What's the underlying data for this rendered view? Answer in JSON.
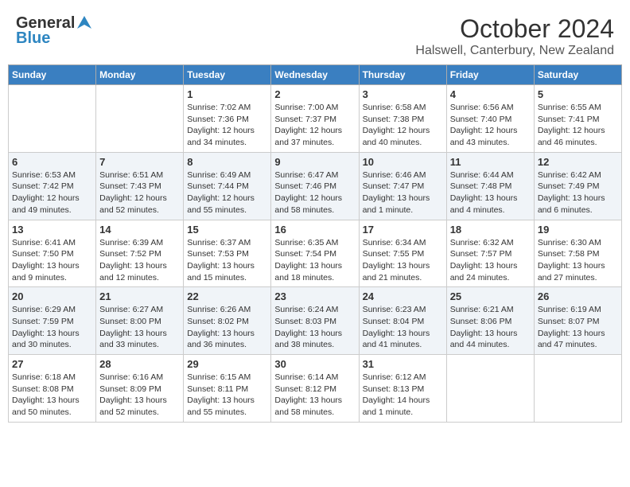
{
  "header": {
    "logo_general": "General",
    "logo_blue": "Blue",
    "month_title": "October 2024",
    "location": "Halswell, Canterbury, New Zealand"
  },
  "days_of_week": [
    "Sunday",
    "Monday",
    "Tuesday",
    "Wednesday",
    "Thursday",
    "Friday",
    "Saturday"
  ],
  "weeks": [
    [
      {
        "day": "",
        "info": ""
      },
      {
        "day": "",
        "info": ""
      },
      {
        "day": "1",
        "sunrise": "Sunrise: 7:02 AM",
        "sunset": "Sunset: 7:36 PM",
        "daylight": "Daylight: 12 hours and 34 minutes."
      },
      {
        "day": "2",
        "sunrise": "Sunrise: 7:00 AM",
        "sunset": "Sunset: 7:37 PM",
        "daylight": "Daylight: 12 hours and 37 minutes."
      },
      {
        "day": "3",
        "sunrise": "Sunrise: 6:58 AM",
        "sunset": "Sunset: 7:38 PM",
        "daylight": "Daylight: 12 hours and 40 minutes."
      },
      {
        "day": "4",
        "sunrise": "Sunrise: 6:56 AM",
        "sunset": "Sunset: 7:40 PM",
        "daylight": "Daylight: 12 hours and 43 minutes."
      },
      {
        "day": "5",
        "sunrise": "Sunrise: 6:55 AM",
        "sunset": "Sunset: 7:41 PM",
        "daylight": "Daylight: 12 hours and 46 minutes."
      }
    ],
    [
      {
        "day": "6",
        "sunrise": "Sunrise: 6:53 AM",
        "sunset": "Sunset: 7:42 PM",
        "daylight": "Daylight: 12 hours and 49 minutes."
      },
      {
        "day": "7",
        "sunrise": "Sunrise: 6:51 AM",
        "sunset": "Sunset: 7:43 PM",
        "daylight": "Daylight: 12 hours and 52 minutes."
      },
      {
        "day": "8",
        "sunrise": "Sunrise: 6:49 AM",
        "sunset": "Sunset: 7:44 PM",
        "daylight": "Daylight: 12 hours and 55 minutes."
      },
      {
        "day": "9",
        "sunrise": "Sunrise: 6:47 AM",
        "sunset": "Sunset: 7:46 PM",
        "daylight": "Daylight: 12 hours and 58 minutes."
      },
      {
        "day": "10",
        "sunrise": "Sunrise: 6:46 AM",
        "sunset": "Sunset: 7:47 PM",
        "daylight": "Daylight: 13 hours and 1 minute."
      },
      {
        "day": "11",
        "sunrise": "Sunrise: 6:44 AM",
        "sunset": "Sunset: 7:48 PM",
        "daylight": "Daylight: 13 hours and 4 minutes."
      },
      {
        "day": "12",
        "sunrise": "Sunrise: 6:42 AM",
        "sunset": "Sunset: 7:49 PM",
        "daylight": "Daylight: 13 hours and 6 minutes."
      }
    ],
    [
      {
        "day": "13",
        "sunrise": "Sunrise: 6:41 AM",
        "sunset": "Sunset: 7:50 PM",
        "daylight": "Daylight: 13 hours and 9 minutes."
      },
      {
        "day": "14",
        "sunrise": "Sunrise: 6:39 AM",
        "sunset": "Sunset: 7:52 PM",
        "daylight": "Daylight: 13 hours and 12 minutes."
      },
      {
        "day": "15",
        "sunrise": "Sunrise: 6:37 AM",
        "sunset": "Sunset: 7:53 PM",
        "daylight": "Daylight: 13 hours and 15 minutes."
      },
      {
        "day": "16",
        "sunrise": "Sunrise: 6:35 AM",
        "sunset": "Sunset: 7:54 PM",
        "daylight": "Daylight: 13 hours and 18 minutes."
      },
      {
        "day": "17",
        "sunrise": "Sunrise: 6:34 AM",
        "sunset": "Sunset: 7:55 PM",
        "daylight": "Daylight: 13 hours and 21 minutes."
      },
      {
        "day": "18",
        "sunrise": "Sunrise: 6:32 AM",
        "sunset": "Sunset: 7:57 PM",
        "daylight": "Daylight: 13 hours and 24 minutes."
      },
      {
        "day": "19",
        "sunrise": "Sunrise: 6:30 AM",
        "sunset": "Sunset: 7:58 PM",
        "daylight": "Daylight: 13 hours and 27 minutes."
      }
    ],
    [
      {
        "day": "20",
        "sunrise": "Sunrise: 6:29 AM",
        "sunset": "Sunset: 7:59 PM",
        "daylight": "Daylight: 13 hours and 30 minutes."
      },
      {
        "day": "21",
        "sunrise": "Sunrise: 6:27 AM",
        "sunset": "Sunset: 8:00 PM",
        "daylight": "Daylight: 13 hours and 33 minutes."
      },
      {
        "day": "22",
        "sunrise": "Sunrise: 6:26 AM",
        "sunset": "Sunset: 8:02 PM",
        "daylight": "Daylight: 13 hours and 36 minutes."
      },
      {
        "day": "23",
        "sunrise": "Sunrise: 6:24 AM",
        "sunset": "Sunset: 8:03 PM",
        "daylight": "Daylight: 13 hours and 38 minutes."
      },
      {
        "day": "24",
        "sunrise": "Sunrise: 6:23 AM",
        "sunset": "Sunset: 8:04 PM",
        "daylight": "Daylight: 13 hours and 41 minutes."
      },
      {
        "day": "25",
        "sunrise": "Sunrise: 6:21 AM",
        "sunset": "Sunset: 8:06 PM",
        "daylight": "Daylight: 13 hours and 44 minutes."
      },
      {
        "day": "26",
        "sunrise": "Sunrise: 6:19 AM",
        "sunset": "Sunset: 8:07 PM",
        "daylight": "Daylight: 13 hours and 47 minutes."
      }
    ],
    [
      {
        "day": "27",
        "sunrise": "Sunrise: 6:18 AM",
        "sunset": "Sunset: 8:08 PM",
        "daylight": "Daylight: 13 hours and 50 minutes."
      },
      {
        "day": "28",
        "sunrise": "Sunrise: 6:16 AM",
        "sunset": "Sunset: 8:09 PM",
        "daylight": "Daylight: 13 hours and 52 minutes."
      },
      {
        "day": "29",
        "sunrise": "Sunrise: 6:15 AM",
        "sunset": "Sunset: 8:11 PM",
        "daylight": "Daylight: 13 hours and 55 minutes."
      },
      {
        "day": "30",
        "sunrise": "Sunrise: 6:14 AM",
        "sunset": "Sunset: 8:12 PM",
        "daylight": "Daylight: 13 hours and 58 minutes."
      },
      {
        "day": "31",
        "sunrise": "Sunrise: 6:12 AM",
        "sunset": "Sunset: 8:13 PM",
        "daylight": "Daylight: 14 hours and 1 minute."
      },
      {
        "day": "",
        "info": ""
      },
      {
        "day": "",
        "info": ""
      }
    ]
  ]
}
